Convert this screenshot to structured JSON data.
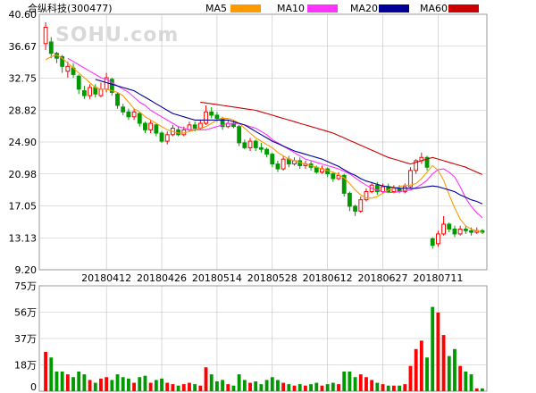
{
  "title": "合纵科技(300477)",
  "watermark": "SOHU.com",
  "legend": [
    {
      "label": "MA5",
      "color": "#ff9900"
    },
    {
      "label": "MA10",
      "color": "#ff33ff"
    },
    {
      "label": "MA20",
      "color": "#000099"
    },
    {
      "label": "MA60",
      "color": "#cc0000"
    }
  ],
  "colors": {
    "up": "#ff0000",
    "down": "#009900",
    "grid": "#c0c0c0",
    "border": "#999999"
  },
  "chart_data": {
    "type": "candlestick",
    "price_axis": {
      "ticks": [
        "40.60",
        "36.67",
        "32.75",
        "28.82",
        "24.90",
        "20.98",
        "17.05",
        "13.13",
        "9.20"
      ],
      "min": 9.2,
      "max": 40.6
    },
    "volume_axis": {
      "ticks": [
        "75万",
        "56万",
        "37万",
        "18万",
        "0"
      ],
      "min": 0,
      "max": 75
    },
    "x_tick_labels": [
      {
        "label": "20180412",
        "index": 11
      },
      {
        "label": "20180426",
        "index": 21
      },
      {
        "label": "20180514",
        "index": 31
      },
      {
        "label": "20180528",
        "index": 41
      },
      {
        "label": "20180612",
        "index": 51
      },
      {
        "label": "20180627",
        "index": 61
      },
      {
        "label": "20180711",
        "index": 71
      }
    ],
    "candles": [
      [
        37.0,
        39.0,
        39.6,
        36.2,
        28
      ],
      [
        37.2,
        35.8,
        37.8,
        35.2,
        24
      ],
      [
        35.8,
        35.2,
        36.0,
        34.6,
        14
      ],
      [
        35.4,
        34.2,
        35.6,
        33.4,
        14
      ],
      [
        33.6,
        34.2,
        34.8,
        32.8,
        12
      ],
      [
        34.0,
        33.2,
        34.6,
        32.8,
        10
      ],
      [
        33.0,
        31.4,
        33.2,
        30.8,
        14
      ],
      [
        31.2,
        30.6,
        31.8,
        30.2,
        12
      ],
      [
        30.6,
        31.6,
        32.0,
        30.2,
        8
      ],
      [
        31.6,
        30.8,
        32.0,
        30.4,
        6
      ],
      [
        30.6,
        31.4,
        32.2,
        30.4,
        9
      ],
      [
        31.4,
        32.8,
        33.4,
        31.0,
        10
      ],
      [
        32.6,
        31.0,
        32.8,
        30.6,
        8
      ],
      [
        30.8,
        29.4,
        31.0,
        29.0,
        12
      ],
      [
        29.2,
        28.6,
        29.6,
        28.2,
        10
      ],
      [
        28.6,
        28.0,
        29.0,
        27.6,
        9
      ],
      [
        28.0,
        28.6,
        29.0,
        27.6,
        6
      ],
      [
        28.4,
        27.2,
        28.6,
        26.8,
        10
      ],
      [
        27.2,
        26.4,
        27.4,
        26.0,
        11
      ],
      [
        26.4,
        27.2,
        27.6,
        26.0,
        6
      ],
      [
        27.0,
        26.0,
        27.2,
        25.6,
        8
      ],
      [
        26.0,
        25.0,
        26.2,
        24.8,
        9
      ],
      [
        25.0,
        25.8,
        26.2,
        24.6,
        6
      ],
      [
        25.8,
        26.6,
        27.0,
        25.6,
        5
      ],
      [
        26.4,
        25.8,
        26.8,
        25.6,
        4
      ],
      [
        25.8,
        26.4,
        26.8,
        25.6,
        5
      ],
      [
        26.4,
        27.0,
        27.4,
        26.2,
        6
      ],
      [
        27.0,
        26.6,
        27.4,
        26.2,
        5
      ],
      [
        26.6,
        27.2,
        27.6,
        26.4,
        4
      ],
      [
        27.2,
        28.6,
        29.4,
        27.0,
        17
      ],
      [
        28.6,
        28.2,
        29.2,
        27.8,
        12
      ],
      [
        28.2,
        27.8,
        28.6,
        27.4,
        7
      ],
      [
        27.8,
        26.8,
        28.0,
        26.4,
        8
      ],
      [
        26.8,
        27.2,
        27.6,
        26.6,
        5
      ],
      [
        27.2,
        26.8,
        27.6,
        26.6,
        4
      ],
      [
        26.8,
        24.8,
        27.0,
        24.4,
        12
      ],
      [
        24.8,
        24.2,
        25.2,
        24.0,
        8
      ],
      [
        24.2,
        25.0,
        25.4,
        23.8,
        6
      ],
      [
        25.0,
        24.2,
        25.2,
        23.8,
        7
      ],
      [
        24.2,
        24.0,
        24.8,
        23.6,
        5
      ],
      [
        24.0,
        23.4,
        24.2,
        23.0,
        8
      ],
      [
        23.4,
        22.2,
        23.6,
        21.8,
        10
      ],
      [
        22.2,
        21.6,
        22.6,
        21.2,
        8
      ],
      [
        21.6,
        22.8,
        23.2,
        21.4,
        6
      ],
      [
        22.8,
        22.2,
        23.2,
        21.8,
        5
      ],
      [
        22.2,
        22.6,
        23.0,
        22.0,
        4
      ],
      [
        22.6,
        22.0,
        23.0,
        21.6,
        5
      ],
      [
        22.0,
        22.2,
        22.6,
        21.6,
        4
      ],
      [
        22.2,
        21.8,
        22.6,
        21.4,
        5
      ],
      [
        21.8,
        21.2,
        22.0,
        21.0,
        6
      ],
      [
        21.2,
        21.6,
        22.0,
        21.0,
        4
      ],
      [
        21.6,
        21.0,
        21.8,
        20.6,
        5
      ],
      [
        21.0,
        20.4,
        21.2,
        20.0,
        6
      ],
      [
        20.4,
        20.8,
        21.2,
        20.2,
        5
      ],
      [
        20.8,
        18.6,
        21.0,
        18.2,
        14
      ],
      [
        18.6,
        17.0,
        18.8,
        16.4,
        14
      ],
      [
        17.0,
        16.4,
        17.2,
        15.8,
        10
      ],
      [
        16.4,
        17.8,
        18.2,
        16.2,
        12
      ],
      [
        17.8,
        18.8,
        19.2,
        17.6,
        10
      ],
      [
        18.8,
        19.6,
        20.0,
        18.6,
        8
      ],
      [
        19.6,
        18.8,
        20.0,
        18.4,
        6
      ],
      [
        18.8,
        19.4,
        19.8,
        18.6,
        5
      ],
      [
        19.4,
        18.8,
        19.8,
        18.6,
        4
      ],
      [
        18.8,
        19.2,
        19.6,
        18.6,
        4
      ],
      [
        19.2,
        18.8,
        19.6,
        18.6,
        4
      ],
      [
        18.8,
        19.4,
        19.8,
        18.6,
        5
      ],
      [
        19.4,
        21.4,
        21.8,
        19.2,
        18
      ],
      [
        21.4,
        22.6,
        22.8,
        21.0,
        30
      ],
      [
        22.6,
        23.0,
        23.6,
        22.2,
        36
      ],
      [
        23.0,
        21.8,
        23.2,
        21.4,
        24
      ],
      [
        13.0,
        12.2,
        13.2,
        11.8,
        60
      ],
      [
        12.4,
        13.6,
        14.0,
        12.0,
        56
      ],
      [
        13.6,
        14.8,
        15.8,
        13.4,
        40
      ],
      [
        14.8,
        14.2,
        15.0,
        13.8,
        25
      ],
      [
        14.2,
        13.6,
        14.6,
        13.2,
        30
      ],
      [
        13.6,
        14.2,
        14.6,
        13.4,
        18
      ],
      [
        14.2,
        14.0,
        14.6,
        13.6,
        14
      ],
      [
        14.0,
        13.8,
        14.4,
        13.4,
        12
      ],
      [
        13.8,
        14.0,
        14.4,
        13.6,
        2
      ],
      [
        14.0,
        13.8,
        14.2,
        13.6,
        2
      ]
    ],
    "ma_series": [
      {
        "name": "MA5",
        "values": [
          35.0,
          35.4,
          35.6,
          35.2,
          34.6,
          34.0,
          33.4,
          32.8,
          32.2,
          31.6,
          31.4,
          31.4,
          31.2,
          31.0,
          30.6,
          29.8,
          29.0,
          28.6,
          28.0,
          27.6,
          27.2,
          26.8,
          26.4,
          26.2,
          26.0,
          26.0,
          26.2,
          26.4,
          26.6,
          26.8,
          27.2,
          27.6,
          27.8,
          27.8,
          27.6,
          27.2,
          26.6,
          26.0,
          25.4,
          25.0,
          24.6,
          24.2,
          23.6,
          23.2,
          22.8,
          22.6,
          22.4,
          22.2,
          22.0,
          21.8,
          21.6,
          21.4,
          21.2,
          20.9,
          20.5,
          19.8,
          19.0,
          18.4,
          18.0,
          18.0,
          18.2,
          18.6,
          19.0,
          19.2,
          19.4,
          19.6,
          19.6,
          19.8,
          20.4,
          21.2,
          22.0,
          21.4,
          20.2,
          18.4,
          16.8,
          15.4,
          14.6,
          14.2,
          14.0,
          13.8
        ]
      },
      {
        "name": "MA10",
        "values": [
          null,
          null,
          null,
          null,
          35.2,
          34.8,
          34.4,
          34.0,
          33.6,
          33.2,
          32.8,
          32.6,
          32.2,
          31.8,
          31.4,
          31.0,
          30.4,
          29.8,
          29.4,
          28.8,
          28.4,
          28.0,
          27.6,
          27.2,
          26.8,
          26.6,
          26.4,
          26.4,
          26.4,
          26.4,
          26.6,
          26.8,
          27.0,
          27.2,
          27.2,
          27.2,
          27.0,
          26.8,
          26.6,
          26.2,
          25.8,
          25.2,
          24.8,
          24.4,
          24.0,
          23.6,
          23.2,
          22.8,
          22.6,
          22.4,
          22.2,
          22.0,
          21.8,
          21.6,
          21.3,
          21.0,
          20.5,
          20.0,
          19.6,
          19.2,
          19.0,
          18.8,
          18.7,
          18.7,
          18.8,
          18.9,
          19.0,
          19.3,
          19.7,
          20.2,
          21.0,
          21.5,
          21.6,
          21.2,
          20.6,
          19.4,
          18.0,
          17.0,
          16.2,
          15.6
        ]
      },
      {
        "name": "MA20",
        "values": [
          null,
          null,
          null,
          null,
          null,
          null,
          null,
          null,
          null,
          32.6,
          32.4,
          32.2,
          32.0,
          31.8,
          31.6,
          31.4,
          31.2,
          30.8,
          30.4,
          30.0,
          29.6,
          29.2,
          28.8,
          28.4,
          28.2,
          28.0,
          27.8,
          27.6,
          27.6,
          27.6,
          27.6,
          27.6,
          27.6,
          27.6,
          27.4,
          27.2,
          27.0,
          26.6,
          26.2,
          25.8,
          25.4,
          25.0,
          24.7,
          24.4,
          24.1,
          23.8,
          23.6,
          23.4,
          23.2,
          23.0,
          22.8,
          22.5,
          22.2,
          21.9,
          21.5,
          21.1,
          20.8,
          20.4,
          20.1,
          19.9,
          19.7,
          19.5,
          19.4,
          19.3,
          19.2,
          19.2,
          19.2,
          19.2,
          19.3,
          19.4,
          19.5,
          19.4,
          19.2,
          19.0,
          18.8,
          18.4,
          18.1,
          17.8,
          17.6,
          17.3
        ]
      },
      {
        "name": "MA60",
        "values": [
          null,
          null,
          null,
          null,
          null,
          null,
          null,
          null,
          null,
          null,
          null,
          null,
          null,
          null,
          null,
          null,
          null,
          null,
          null,
          null,
          null,
          null,
          null,
          null,
          null,
          null,
          null,
          null,
          29.8,
          29.7,
          29.6,
          29.5,
          29.4,
          29.3,
          29.2,
          29.1,
          29.0,
          28.9,
          28.8,
          28.6,
          28.4,
          28.2,
          28.0,
          27.8,
          27.6,
          27.4,
          27.2,
          27.0,
          26.8,
          26.6,
          26.4,
          26.2,
          26.0,
          25.7,
          25.4,
          25.1,
          24.8,
          24.5,
          24.2,
          23.9,
          23.6,
          23.3,
          23.0,
          22.8,
          22.6,
          22.4,
          22.2,
          22.4,
          22.6,
          22.8,
          23.0,
          22.8,
          22.6,
          22.4,
          22.2,
          22.0,
          21.8,
          21.5,
          21.2,
          20.9
        ]
      }
    ]
  }
}
